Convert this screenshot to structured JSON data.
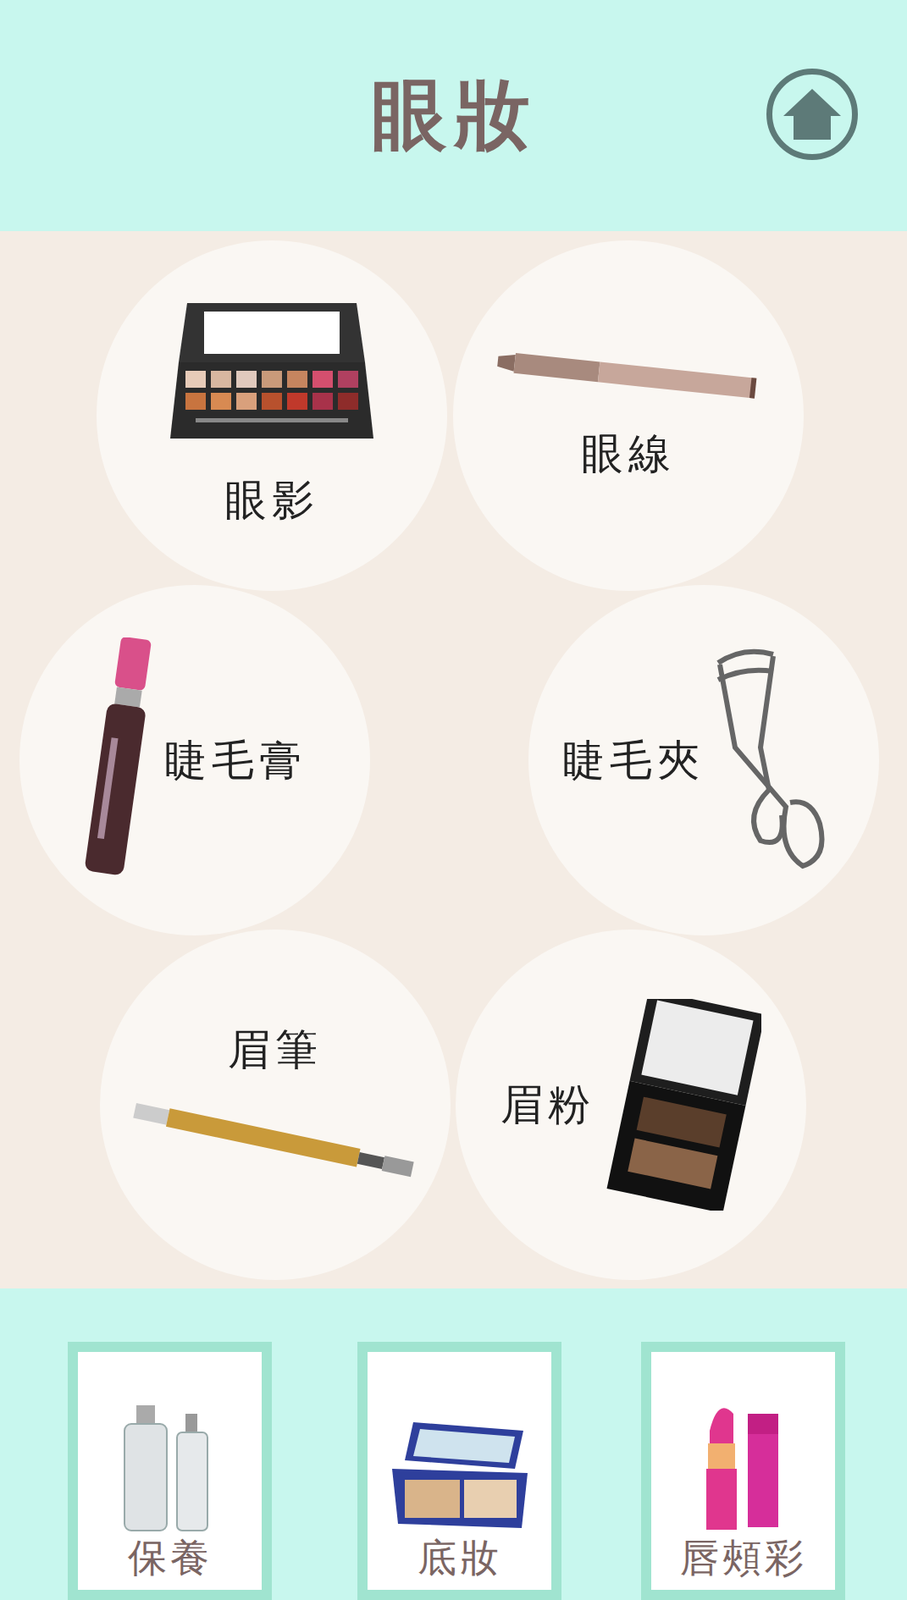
{
  "header": {
    "title": "眼妝"
  },
  "items": [
    {
      "label": "眼影"
    },
    {
      "label": "眼線"
    },
    {
      "label": "睫毛膏"
    },
    {
      "label": "睫毛夾"
    },
    {
      "label": "眉筆"
    },
    {
      "label": "眉粉"
    }
  ],
  "nav": [
    {
      "label": "保養"
    },
    {
      "label": "底妝"
    },
    {
      "label": "唇頰彩"
    }
  ]
}
